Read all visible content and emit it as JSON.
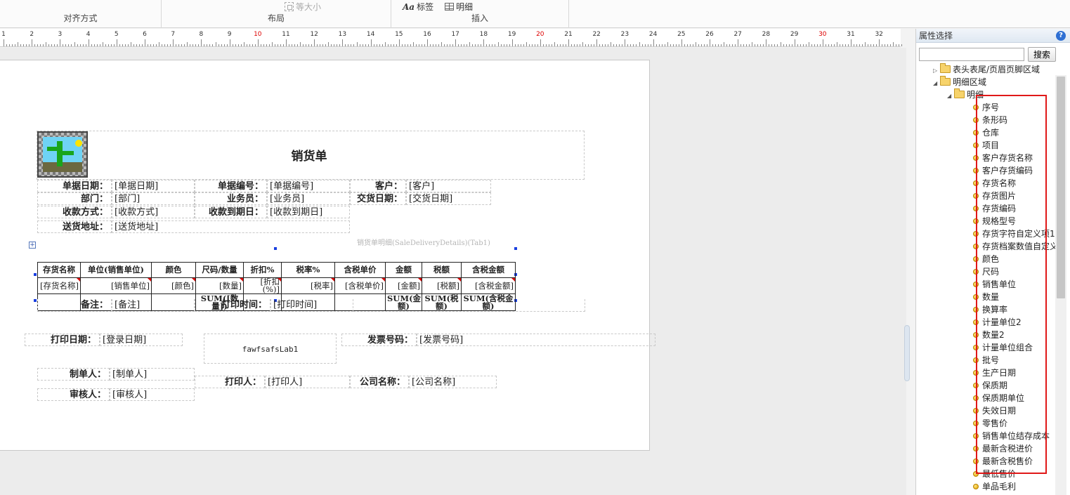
{
  "ribbon": {
    "group_align_label": "对齐方式",
    "group_layout_label": "布局",
    "same_size_label": "等大小",
    "group_insert_label": "插入",
    "label_button": "标签",
    "detail_button": "明细"
  },
  "ruler": {
    "numbers": [
      "1",
      "2",
      "3",
      "4",
      "5",
      "6",
      "7",
      "8",
      "9",
      "10",
      "11",
      "12",
      "13",
      "14",
      "15",
      "16",
      "17",
      "18",
      "19",
      "20",
      "21",
      "22",
      "23",
      "24",
      "25",
      "26",
      "27",
      "28",
      "29",
      "30",
      "31",
      "32"
    ]
  },
  "report": {
    "title": "销货单",
    "header_fields": [
      {
        "label": "单据日期：",
        "value": "[单据日期]"
      },
      {
        "label": "单据编号：",
        "value": "[单据编号]"
      },
      {
        "label": "客户：",
        "value": "[客户]"
      },
      {
        "label": "部门：",
        "value": "[部门]"
      },
      {
        "label": "业务员：",
        "value": "[业务员]"
      },
      {
        "label": "交货日期：",
        "value": "[交货日期]"
      },
      {
        "label": "收款方式：",
        "value": "[收款方式]"
      },
      {
        "label": "收款到期日：",
        "value": "[收款到期日]"
      },
      {
        "label": "送货地址：",
        "value": "[送货地址]"
      }
    ],
    "detail_caption": "销货单明细(SaleDeliveryDetails)(Tab1)",
    "detail_headers": [
      "存货名称",
      "单位(销售单位)",
      "颜色",
      "尺码/数量",
      "折扣%",
      "税率%",
      "含税单价",
      "金额",
      "税额",
      "含税金额"
    ],
    "detail_row": [
      "[存货名称]",
      "[销售单位]",
      "[颜色]",
      "[数量]",
      "[折扣(%)]",
      "[税率]",
      "[含税单价]",
      "[金额]",
      "[税额]",
      "[含税金额]"
    ],
    "detail_footer": [
      "",
      "",
      "",
      "SUM([数量])",
      "",
      "",
      "",
      "SUM(金额)",
      "SUM(税额)",
      "SUM(含税金额)"
    ],
    "remark_label": "备注：",
    "remark_value": "[备注]",
    "print_time_label": "打印时间：",
    "print_time_value": "[打印时间]",
    "print_date_label": "打印日期：",
    "print_date_value": "[登录日期]",
    "free_label": "fawfsafsLab1",
    "invoice_label": "发票号码：",
    "invoice_value": "[发票号码]",
    "maker_label": "制单人：",
    "maker_value": "[制单人]",
    "auditor_label": "审核人：",
    "auditor_value": "[审核人]",
    "printer_label": "打印人：",
    "printer_value": "[打印人]",
    "company_label": "公司名称：",
    "company_value": "[公司名称]"
  },
  "panel": {
    "title": "属性选择",
    "help": "?",
    "search_placeholder": "",
    "search_button": "搜索",
    "tree": {
      "root1": "表头表尾/页眉页脚区域",
      "root2": "明细区域",
      "child": "明细",
      "fields": [
        "序号",
        "条形码",
        "仓库",
        "项目",
        "客户存货名称",
        "客户存货编码",
        "存货名称",
        "存货图片",
        "存货编码",
        "规格型号",
        "存货字符自定义项1",
        "存货档案数值自定义",
        "颜色",
        "尺码",
        "销售单位",
        "数量",
        "换算率",
        "计量单位2",
        "数量2",
        "计量单位组合",
        "批号",
        "生产日期",
        "保质期",
        "保质期单位",
        "失效日期",
        "零售价",
        "销售单位结存成本",
        "最新含税进价",
        "最新含税售价",
        "最低售价",
        "单品毛利"
      ]
    }
  },
  "colors": {
    "highlight": "#e01818",
    "selection_handle": "#1a3fe0"
  }
}
